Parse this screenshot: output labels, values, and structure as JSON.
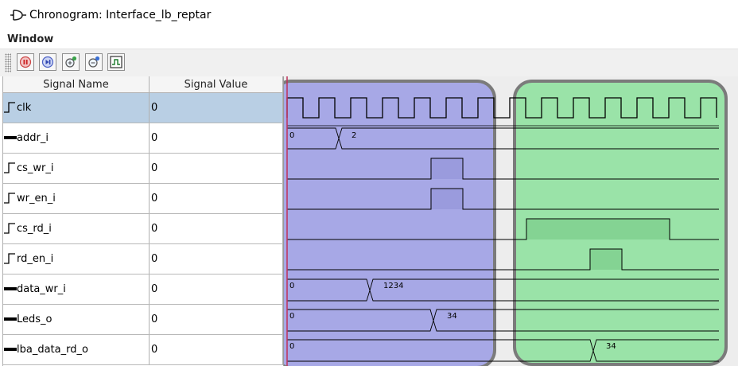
{
  "window": {
    "title": "Chronogram: Interface_lb_reptar"
  },
  "menu": {
    "items": [
      {
        "label": "Window"
      }
    ]
  },
  "toolbar": {
    "buttons": [
      {
        "name": "pause-button",
        "icon": "pause-icon"
      },
      {
        "name": "step-button",
        "icon": "step-forward-icon"
      },
      {
        "name": "zoom-in-button",
        "icon": "zoom-in-icon"
      },
      {
        "name": "zoom-out-button",
        "icon": "zoom-out-icon"
      },
      {
        "name": "waveform-button",
        "icon": "waveform-icon"
      }
    ]
  },
  "table": {
    "headers": {
      "name": "Signal Name",
      "value": "Signal Value"
    },
    "selected_row": 0,
    "signals": [
      {
        "name": "clk",
        "value": "0",
        "type": "bit"
      },
      {
        "name": "addr_i",
        "value": "0",
        "type": "bus"
      },
      {
        "name": "cs_wr_i",
        "value": "0",
        "type": "bit"
      },
      {
        "name": "wr_en_i",
        "value": "0",
        "type": "bit"
      },
      {
        "name": "cs_rd_i",
        "value": "0",
        "type": "bit"
      },
      {
        "name": "rd_en_i",
        "value": "0",
        "type": "bit"
      },
      {
        "name": "data_wr_i",
        "value": "0",
        "type": "bus"
      },
      {
        "name": "Leds_o",
        "value": "0",
        "type": "bus"
      },
      {
        "name": "lba_data_rd_o",
        "value": "0",
        "type": "bus"
      }
    ]
  },
  "waveforms": {
    "addr_i": [
      "0",
      "2"
    ],
    "data_wr_i": [
      "0",
      "1234"
    ],
    "Leds_o": [
      "0",
      "34"
    ],
    "lba_data_rd_o": [
      "0",
      "34"
    ]
  },
  "highlights": [
    {
      "name": "write-phase-highlight",
      "color": "#8d8ee0"
    },
    {
      "name": "read-phase-highlight",
      "color": "#7dd98f"
    }
  ],
  "colors": {
    "selection": "#b9cfe4",
    "cursor": "#c0305a"
  }
}
